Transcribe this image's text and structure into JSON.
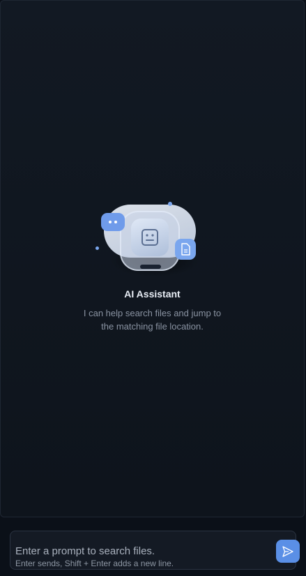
{
  "empty_state": {
    "title": "AI Assistant",
    "description": "I can help search files and jump to the matching file location.",
    "illustration_icons": [
      "chat-bubble-icon",
      "robot-icon",
      "file-icon"
    ]
  },
  "composer": {
    "placeholder": "Enter a prompt to search files.",
    "value": "",
    "hint": "Enter sends, Shift + Enter adds a new line.",
    "send_icon": "send-icon"
  },
  "colors": {
    "background": "#0b1018",
    "accent": "#5a8fe6",
    "panel_border": "#1f2733"
  }
}
